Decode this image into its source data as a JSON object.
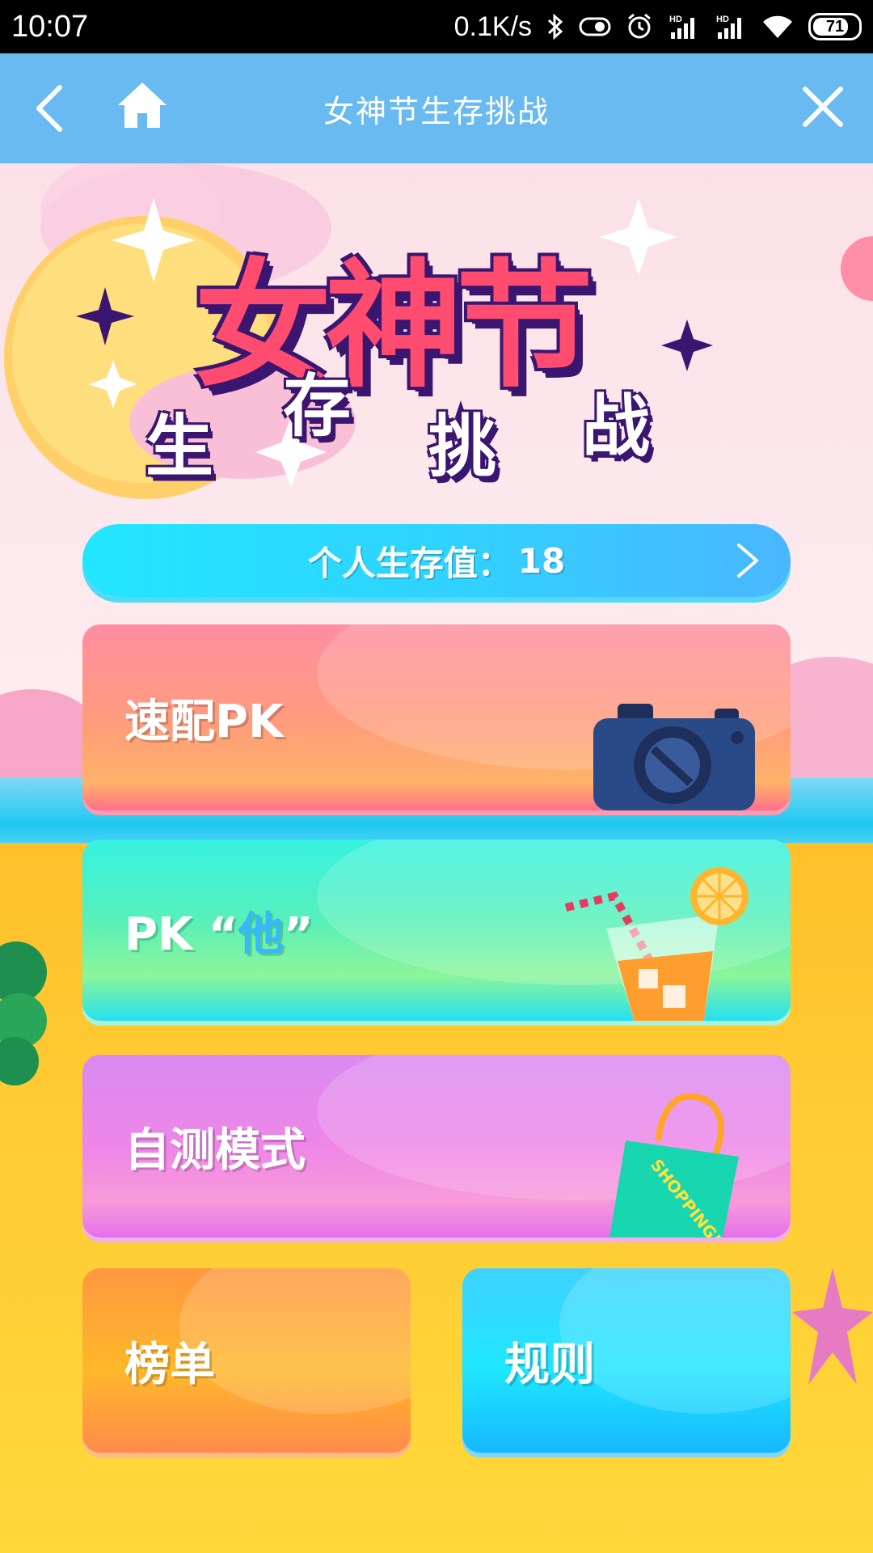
{
  "status_bar": {
    "time": "10:07",
    "net_speed": "0.1K/s",
    "battery": "71",
    "icons": [
      "bluetooth-icon",
      "toggle-icon",
      "alarm-icon",
      "signal-hd-icon",
      "signal-hd-icon-2",
      "wifi-icon",
      "battery-icon"
    ]
  },
  "nav": {
    "title": "女神节生存挑战",
    "icons": [
      "back-icon",
      "home-icon",
      "close-icon"
    ]
  },
  "hero": {
    "title_main": "女神节",
    "title_sub": [
      "生",
      "存",
      "挑",
      "战"
    ]
  },
  "score": {
    "label": "个人生存值：",
    "value": "18"
  },
  "modes": {
    "quick_pk": "速配PK",
    "pk_him_prefix": "PK “",
    "pk_him_accent": "他",
    "pk_him_suffix": "”",
    "self_test": "自测模式",
    "leaderboard": "榜单",
    "rules": "规则"
  },
  "decor": {
    "bag_text": "SHOPPING!"
  },
  "colors": {
    "nav_bg": "#69baf0",
    "title_red": "#ff4c6f",
    "outline_purple": "#3b1670",
    "score_bar": "#2fd3ff",
    "pk_him_accent": "#35b8ff"
  }
}
